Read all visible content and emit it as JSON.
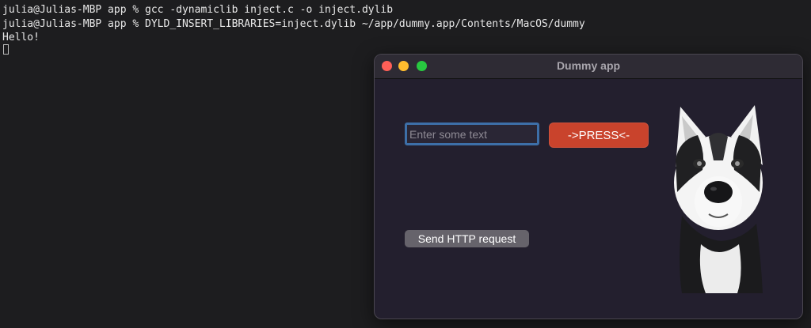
{
  "terminal": {
    "lines": [
      "julia@Julias-MBP app % gcc -dynamiclib inject.c -o inject.dylib",
      "julia@Julias-MBP app % DYLD_INSERT_LIBRARIES=inject.dylib ~/app/dummy.app/Contents/MacOS/dummy",
      "Hello!"
    ]
  },
  "window": {
    "title": "Dummy app",
    "text_input": {
      "value": "",
      "placeholder": "Enter some text"
    },
    "press_button": "->PRESS<-",
    "http_button": "Send HTTP request"
  },
  "colors": {
    "window_bg": "#231f2e",
    "titlebar_bg": "#2e2b34",
    "press_button": "#c9432c",
    "http_button": "#66636b",
    "input_focus_ring": "#3d6fa8",
    "close": "#ff5f57",
    "minimize": "#febc2e",
    "zoom": "#28c840"
  },
  "icons": [
    "close-icon",
    "minimize-icon",
    "zoom-icon"
  ]
}
